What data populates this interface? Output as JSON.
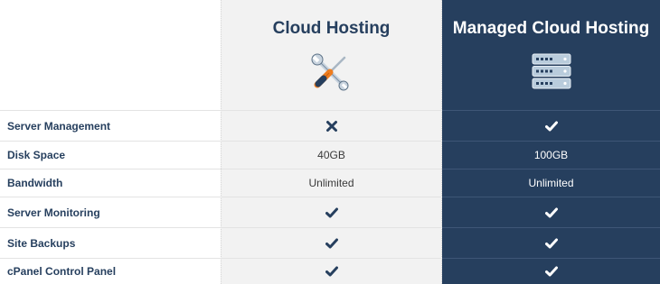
{
  "header": {
    "plans": [
      {
        "title": "Cloud Hosting",
        "icon": "wrench-screwdriver-icon"
      },
      {
        "title": "Managed Cloud Hosting",
        "icon": "server-stack-icon"
      }
    ]
  },
  "rows": [
    {
      "label": "Server Management",
      "plan1": {
        "type": "icon",
        "icon": "cross-icon"
      },
      "plan2": {
        "type": "icon",
        "icon": "check-icon"
      }
    },
    {
      "label": "Disk Space",
      "plan1": {
        "type": "text",
        "text": "40GB"
      },
      "plan2": {
        "type": "text",
        "text": "100GB"
      }
    },
    {
      "label": "Bandwidth",
      "plan1": {
        "type": "text",
        "text": "Unlimited"
      },
      "plan2": {
        "type": "text",
        "text": "Unlimited"
      }
    },
    {
      "label": "Server Monitoring",
      "plan1": {
        "type": "icon",
        "icon": "check-icon"
      },
      "plan2": {
        "type": "icon",
        "icon": "check-icon"
      }
    },
    {
      "label": "Site Backups",
      "plan1": {
        "type": "icon",
        "icon": "check-icon"
      },
      "plan2": {
        "type": "icon",
        "icon": "check-icon"
      }
    },
    {
      "label": "cPanel Control Panel",
      "plan1": {
        "type": "icon",
        "icon": "check-icon"
      },
      "plan2": {
        "type": "icon",
        "icon": "check-icon"
      }
    }
  ],
  "colors": {
    "navy": "#263f5e",
    "light_column": "#f2f2f2",
    "check_light": "#263f5e",
    "check_dark": "#ffffff"
  }
}
